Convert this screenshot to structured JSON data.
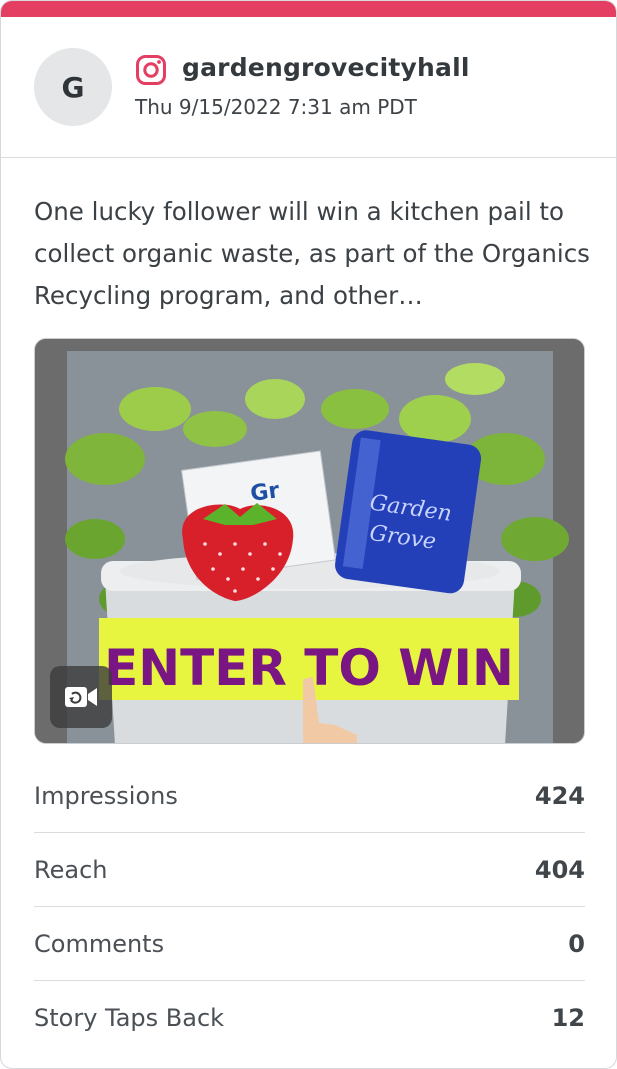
{
  "colors": {
    "accent": "#e43f62",
    "avatar_bg": "#e4e6e8",
    "text": "#3b4145"
  },
  "post": {
    "avatar_initial": "G",
    "platform_icon": "instagram-icon",
    "account": "gardengrovecityhall",
    "timestamp": "Thu 9/15/2022 7:31 am PDT",
    "caption": "One lucky follower will win a kitchen pail to collect organic waste, as part of the Organics Recycling program, and other…",
    "media": {
      "type": "video",
      "banner_text": "ENTER TO WIN",
      "box_text": "Gr",
      "cup_text_1": "Garden",
      "cup_text_2": "Grove",
      "badge_icon": "video-camera-icon"
    }
  },
  "metrics": [
    {
      "label": "Impressions",
      "value": "424"
    },
    {
      "label": "Reach",
      "value": "404"
    },
    {
      "label": "Comments",
      "value": "0"
    },
    {
      "label": "Story Taps Back",
      "value": "12"
    }
  ]
}
